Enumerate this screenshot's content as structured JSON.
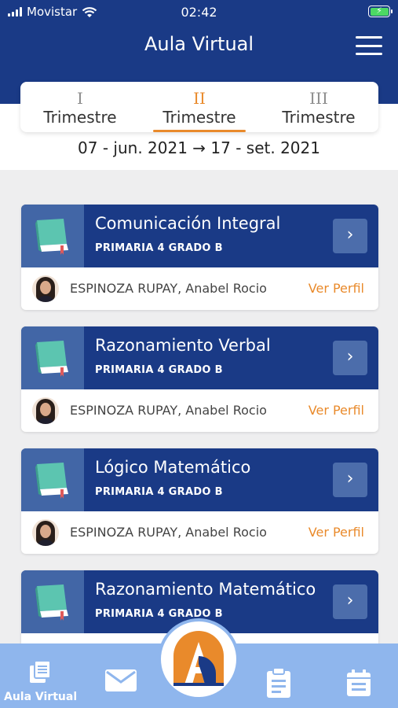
{
  "status_bar": {
    "carrier": "Movistar",
    "time": "02:42"
  },
  "header": {
    "title": "Aula Virtual"
  },
  "tabs": [
    {
      "numeral": "I",
      "label": "Trimestre",
      "active": false
    },
    {
      "numeral": "II",
      "label": "Trimestre",
      "active": true
    },
    {
      "numeral": "III",
      "label": "Trimestre",
      "active": false
    }
  ],
  "date_range": "07 - jun. 2021 → 17 - set. 2021",
  "courses": [
    {
      "title": "Comunicación Integral",
      "grade": "PRIMARIA 4 GRADO B",
      "teacher": "ESPINOZA RUPAY, Anabel Rocio",
      "link": "Ver Perfil"
    },
    {
      "title": "Razonamiento Verbal",
      "grade": "PRIMARIA 4 GRADO B",
      "teacher": "ESPINOZA RUPAY, Anabel Rocio",
      "link": "Ver Perfil"
    },
    {
      "title": "Lógico Matemático",
      "grade": "PRIMARIA 4 GRADO B",
      "teacher": "ESPINOZA RUPAY, Anabel Rocio",
      "link": "Ver Perfil"
    },
    {
      "title": "Razonamiento Matemático",
      "grade": "PRIMARIA 4 GRADO B",
      "teacher": "",
      "link": ""
    }
  ],
  "bottom_nav": {
    "aula_label": "Aula Virtual"
  },
  "colors": {
    "primary": "#1a3a86",
    "accent": "#e98a2b",
    "nav_bg": "#8fb6ed",
    "book_green": "#5cc5b0"
  },
  "icons": [
    "wifi-icon",
    "battery-icon",
    "menu-icon",
    "book-icon",
    "chevron-right-icon",
    "documents-icon",
    "mail-icon",
    "clipboard-icon",
    "calendar-icon"
  ]
}
